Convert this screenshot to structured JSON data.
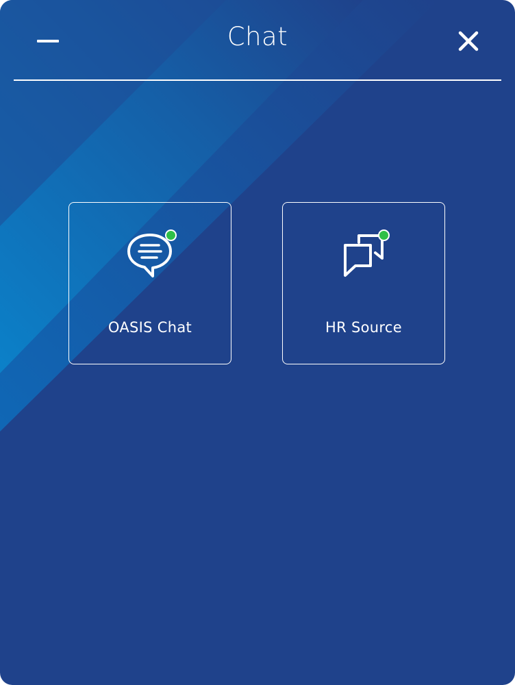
{
  "header": {
    "title": "Chat",
    "minimize_icon": "minus-icon",
    "close_icon": "close-icon"
  },
  "options": [
    {
      "label": "OASIS Chat",
      "icon": "speech-bubble-lines-icon",
      "status": "online",
      "status_color": "#2fbf47"
    },
    {
      "label": "HR Source",
      "icon": "double-chat-bubbles-icon",
      "status": "online",
      "status_color": "#2fbf47"
    }
  ],
  "colors": {
    "background": "#1f428b",
    "accent_stripe": "#0a7fc8",
    "foreground": "#ffffff"
  }
}
